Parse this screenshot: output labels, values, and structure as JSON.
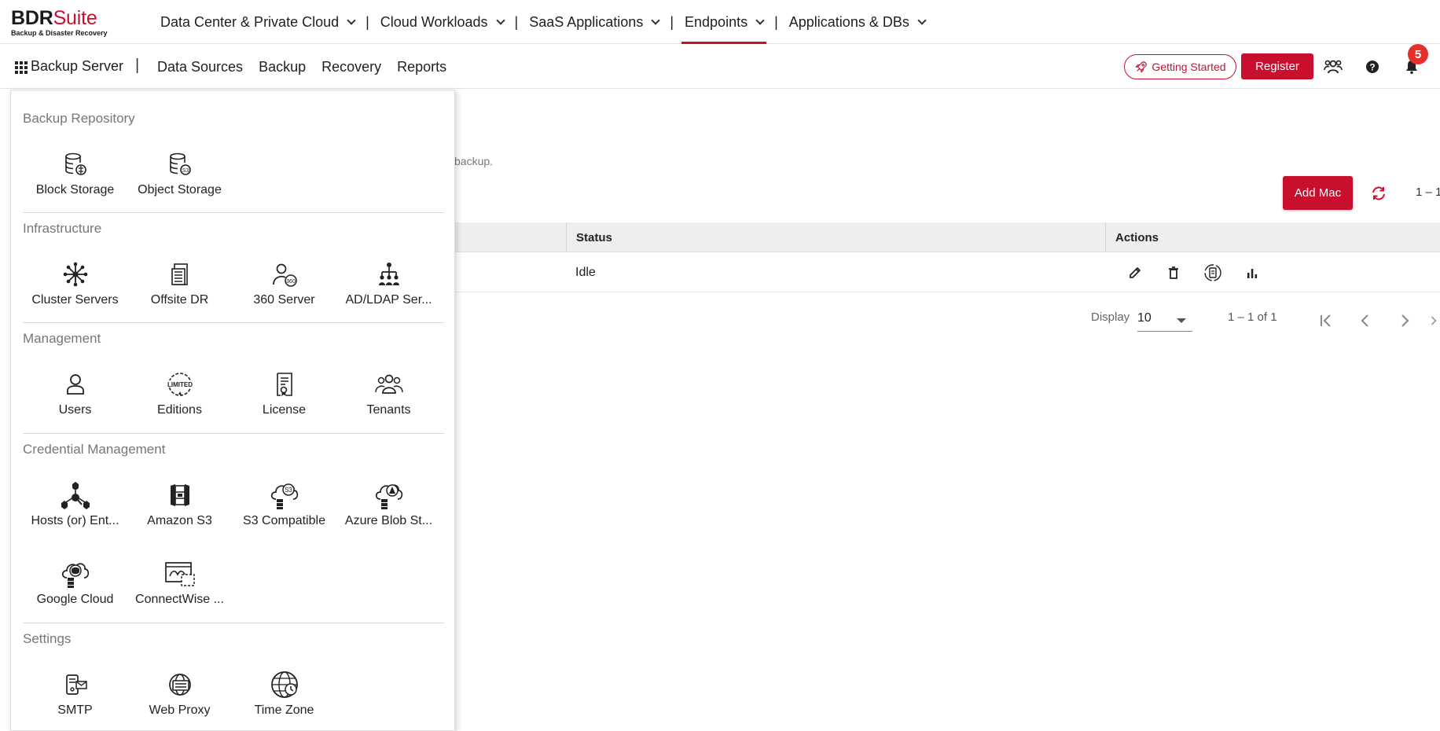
{
  "brand": {
    "logo_main": "BDR",
    "logo_accent": "Suite",
    "logo_sub": "Backup & Disaster Recovery",
    "accent_color": "#c8102e"
  },
  "top_nav": [
    {
      "label": "Data Center & Private Cloud"
    },
    {
      "label": "Cloud Workloads"
    },
    {
      "label": "SaaS Applications"
    },
    {
      "label": "Endpoints",
      "active": true
    },
    {
      "label": "Applications & DBs"
    }
  ],
  "top_nav_separator": "|",
  "sub_bar": {
    "title": "Backup Server",
    "separator": "|",
    "items": [
      {
        "label": "Data Sources"
      },
      {
        "label": "Backup"
      },
      {
        "label": "Recovery"
      },
      {
        "label": "Reports"
      }
    ],
    "getting_started": "Getting Started",
    "register": "Register",
    "notification_count": "5"
  },
  "page": {
    "description": "backup.",
    "add_button": "Add Mac",
    "range_top": "1 – 1",
    "table": {
      "columns": [
        {
          "label": "Status"
        },
        {
          "label": "Actions"
        }
      ],
      "rows": [
        {
          "status": "Idle"
        }
      ]
    },
    "pager": {
      "display_label": "Display",
      "page_size": "10",
      "range": "1 – 1 of 1"
    }
  },
  "menu": {
    "sections": [
      {
        "title": "Backup Repository",
        "items": [
          {
            "label": "Block Storage",
            "icon": "block-storage-icon"
          },
          {
            "label": "Object Storage",
            "icon": "object-storage-icon"
          }
        ]
      },
      {
        "title": "Infrastructure",
        "items": [
          {
            "label": "Cluster Servers",
            "icon": "cluster-icon"
          },
          {
            "label": "Offsite DR",
            "icon": "offsite-dr-icon"
          },
          {
            "label": "360 Server",
            "icon": "server-360-icon"
          },
          {
            "label": "AD/LDAP Ser...",
            "icon": "ldap-icon"
          }
        ]
      },
      {
        "title": "Management",
        "items": [
          {
            "label": "Users",
            "icon": "user-icon"
          },
          {
            "label": "Editions",
            "icon": "editions-icon"
          },
          {
            "label": "License",
            "icon": "license-icon"
          },
          {
            "label": "Tenants",
            "icon": "tenants-icon"
          }
        ]
      },
      {
        "title": "Credential Management",
        "items": [
          {
            "label": "Hosts (or) Ent...",
            "icon": "hosts-icon"
          },
          {
            "label": "Amazon S3",
            "icon": "amazon-s3-icon"
          },
          {
            "label": "S3 Compatible",
            "icon": "s3-compatible-icon"
          },
          {
            "label": "Azure Blob St...",
            "icon": "azure-blob-icon"
          },
          {
            "label": "Google Cloud",
            "icon": "google-cloud-icon"
          },
          {
            "label": "ConnectWise ...",
            "icon": "connectwise-icon"
          }
        ]
      },
      {
        "title": "Settings",
        "items": [
          {
            "label": "SMTP",
            "icon": "smtp-icon"
          },
          {
            "label": "Web Proxy",
            "icon": "web-proxy-icon"
          },
          {
            "label": "Time Zone",
            "icon": "time-zone-icon"
          }
        ]
      }
    ]
  }
}
